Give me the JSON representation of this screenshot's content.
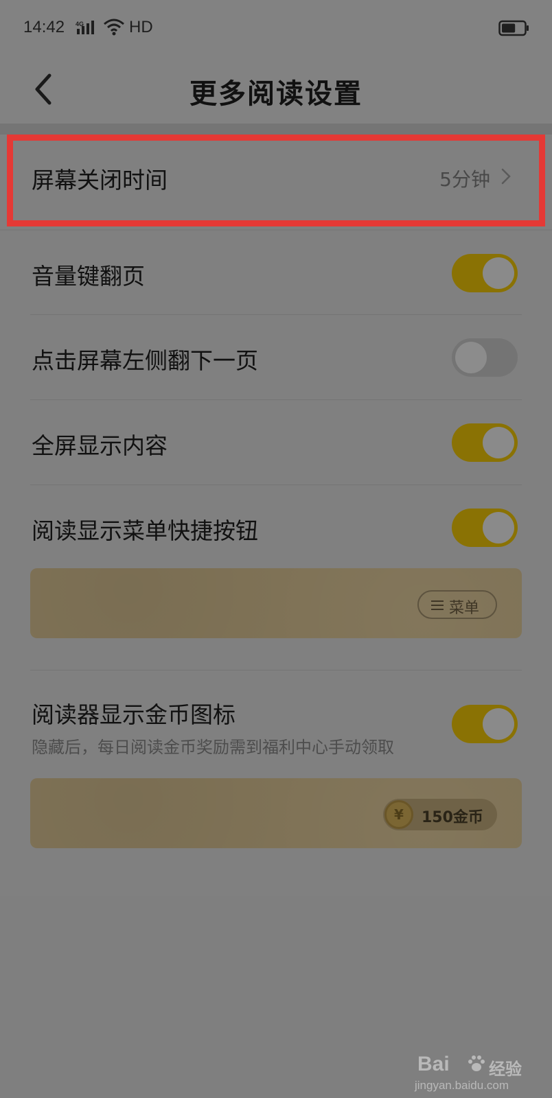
{
  "status_bar": {
    "time": "14:42",
    "network": "4G",
    "hd": "HD",
    "battery_level": 0.6
  },
  "header": {
    "title": "更多阅读设置"
  },
  "settings": {
    "screen_off": {
      "label": "屏幕关闭时间",
      "value": "5分钟"
    },
    "volume_key": {
      "label": "音量键翻页",
      "on": true
    },
    "tap_left": {
      "label": "点击屏幕左侧翻下一页",
      "on": false
    },
    "fullscreen": {
      "label": "全屏显示内容",
      "on": true
    },
    "menu_button": {
      "label": "阅读显示菜单快捷按钮",
      "on": true,
      "preview_chip": "菜单"
    },
    "coin_icon": {
      "label": "阅读器显示金币图标",
      "sub": "隐藏后，每日阅读金币奖励需到福利中心手动领取",
      "on": true,
      "preview_coin_symbol": "¥",
      "preview_chip": "150金币"
    }
  },
  "colors": {
    "highlight": "#e53935",
    "toggle_on": "#8a7204",
    "toggle_off": "#747474"
  },
  "watermark": {
    "brand": "Bai",
    "brand_cn": "经验",
    "url": "jingyan.baidu.com"
  }
}
